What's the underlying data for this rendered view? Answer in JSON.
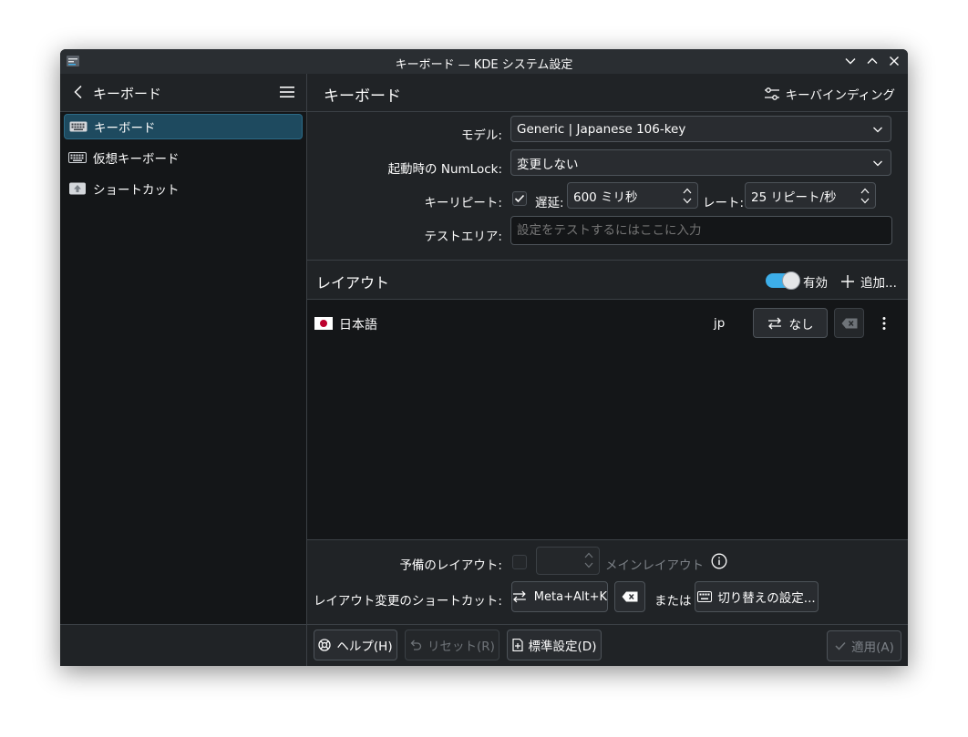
{
  "window": {
    "title": "キーボード — KDE システム設定"
  },
  "sidebar": {
    "header": "キーボード",
    "items": [
      {
        "label": "キーボード",
        "active": true
      },
      {
        "label": "仮想キーボード",
        "active": false
      },
      {
        "label": "ショートカット",
        "active": false
      }
    ]
  },
  "main": {
    "title": "キーボード",
    "key_bindings_label": "キーバインディング",
    "form": {
      "model_label": "モデル:",
      "model_value": "Generic | Japanese 106-key",
      "numlock_label": "起動時の NumLock:",
      "numlock_value": "変更しない",
      "repeat_label": "キーリピート:",
      "repeat_checked": true,
      "delay_label": "遅延:",
      "delay_value": "600 ミリ秒",
      "rate_label": "レート:",
      "rate_value": "25 リピート/秒",
      "test_label": "テストエリア:",
      "test_placeholder": "設定をテストするにはここに入力"
    },
    "layouts": {
      "title": "レイアウト",
      "enabled_label": "有効",
      "enabled": true,
      "add_label": "追加...",
      "rows": [
        {
          "flag": "🇯🇵",
          "name": "日本語",
          "code": "jp",
          "shortcut": "なし"
        }
      ]
    },
    "bottom": {
      "spare_label": "予備のレイアウト:",
      "main_layout_label": "メインレイアウト",
      "switch_label": "レイアウト変更のショートカット:",
      "shortcut_value": "Meta+Alt+K",
      "or_label": "または",
      "switch_settings_label": "切り替えの設定..."
    },
    "footer": {
      "help": "ヘルプ(H)",
      "reset": "リセット(R)",
      "defaults": "標準設定(D)",
      "apply": "適用(A)"
    }
  },
  "colors": {
    "accent": "#3daee9",
    "window_bg": "#202326",
    "sidebar_bg": "#141618",
    "active_item": "#1e4a5f"
  }
}
